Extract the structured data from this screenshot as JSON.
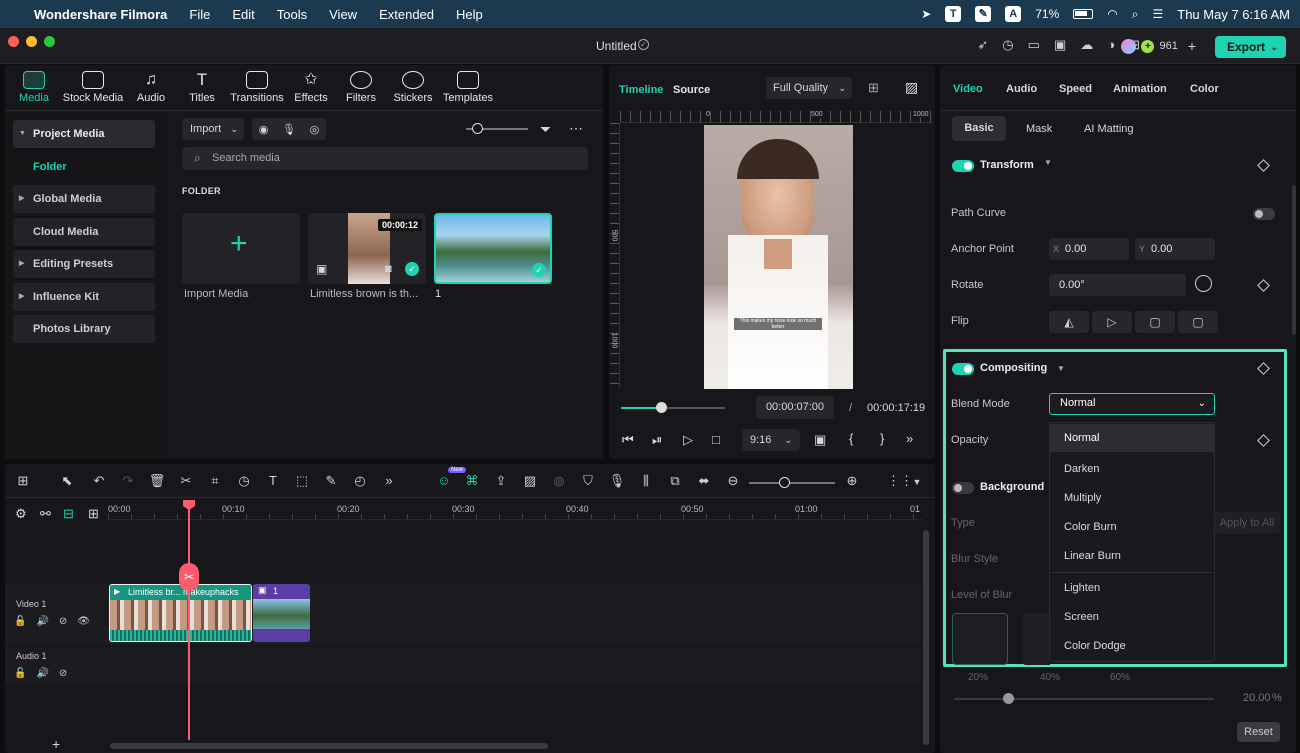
{
  "menubar": {
    "app": "Wondershare Filmora",
    "menus": [
      "File",
      "Edit",
      "Tools",
      "View",
      "Extended",
      "Help"
    ],
    "battery": "71%",
    "datetime": "Thu May 7  6:16 AM"
  },
  "titlebar": {
    "title": "Untitled",
    "credits": "961",
    "export": "Export"
  },
  "media_tabs": [
    "Media",
    "Stock Media",
    "Audio",
    "Titles",
    "Transitions",
    "Effects",
    "Filters",
    "Stickers",
    "Templates"
  ],
  "sidebar": [
    "Project Media",
    "Folder",
    "Global Media",
    "Cloud Media",
    "Editing Presets",
    "Influence Kit",
    "Photos Library"
  ],
  "library": {
    "import": "Import",
    "search_placeholder": "Search media",
    "folder_heading": "FOLDER",
    "items": [
      {
        "label": "Import Media"
      },
      {
        "label": "Limitless brown is th...",
        "duration": "00:00:12"
      },
      {
        "label": "1"
      }
    ]
  },
  "preview": {
    "tab_timeline": "Timeline",
    "tab_source": "Source",
    "quality": "Full Quality",
    "current": "00:00:07:00",
    "sep": "/",
    "total": "00:00:17:19",
    "ratio": "9:16",
    "ruler": [
      "0",
      "500",
      "1000"
    ],
    "vruler": [
      "500",
      "1000"
    ],
    "caption": "This makes my nose look so much better"
  },
  "props": {
    "tabs": [
      "Video",
      "Audio",
      "Speed",
      "Animation",
      "Color"
    ],
    "subtabs": [
      "Basic",
      "Mask",
      "AI Matting"
    ],
    "transform": "Transform",
    "path_curve": "Path Curve",
    "anchor": "Anchor Point",
    "ax": "X",
    "ay": "Y",
    "anchor_x": "0.00",
    "anchor_y": "0.00",
    "rotate": "Rotate",
    "rotate_val": "0.00°",
    "flip": "Flip",
    "compositing": "Compositing",
    "blend_mode": "Blend Mode",
    "blend_val": "Normal",
    "opacity": "Opacity",
    "background": "Background",
    "type": "Type",
    "apply_all": "Apply to All",
    "blur_style": "Blur Style",
    "level_blur": "Level of Blur",
    "pcts": [
      "20%",
      "40%",
      "60%"
    ],
    "pct_val": "20.00",
    "pct_unit": "%",
    "reset": "Reset",
    "blend_options": [
      "Normal",
      "Darken",
      "Multiply",
      "Color Burn",
      "Linear Burn",
      "Lighten",
      "Screen",
      "Color Dodge"
    ]
  },
  "timeline": {
    "ruler": [
      "00:00",
      "00:10",
      "00:20",
      "00:30",
      "00:40",
      "00:50",
      "01:00",
      "01"
    ],
    "video_track": "Video 1",
    "audio_track": "Audio 1",
    "clip1": "Limitless br... makeuphacks",
    "clip2": "1",
    "badge": "New"
  }
}
